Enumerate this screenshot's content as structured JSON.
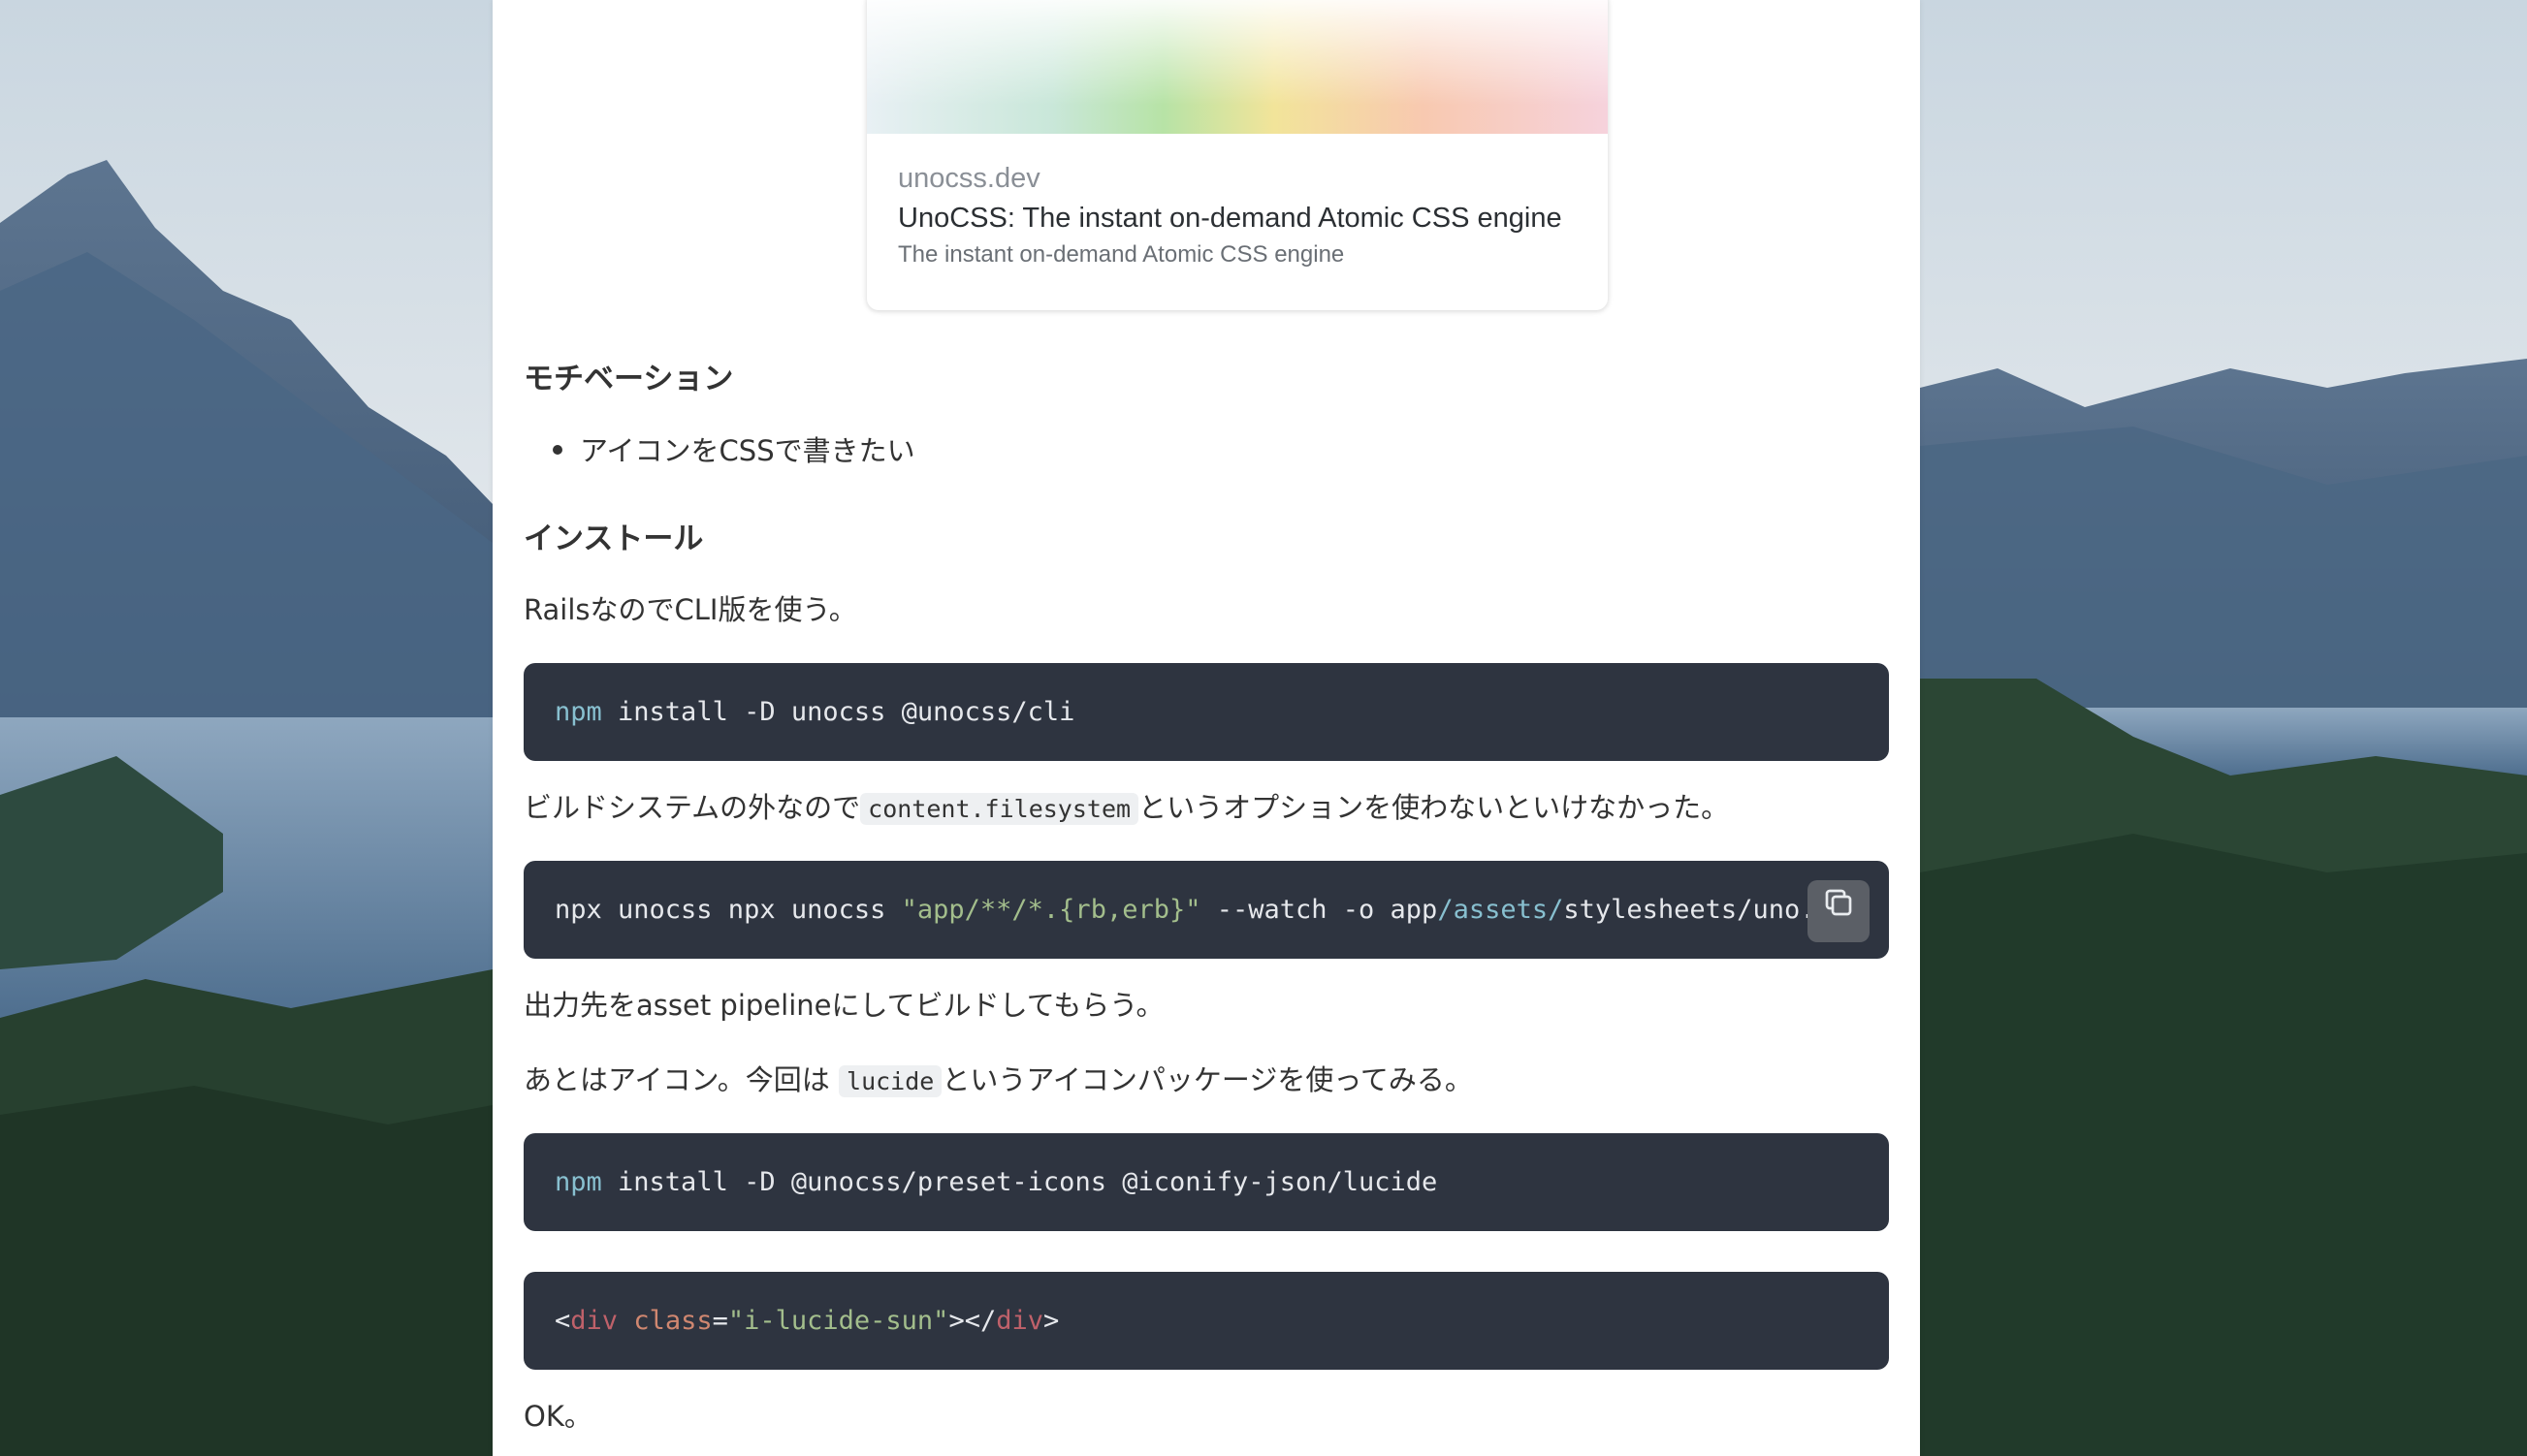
{
  "card": {
    "domain": "unocss.dev",
    "title": "UnoCSS: The instant on-demand Atomic CSS engine",
    "description": "The instant on-demand Atomic CSS engine"
  },
  "sections": {
    "motivation_heading": "モチベーション",
    "motivation_bullet": "アイコンをCSSで書きたい",
    "install_heading": "インストール"
  },
  "paragraphs": {
    "p1": "RailsなのでCLI版を使う。",
    "p2_before": "ビルドシステムの外なので",
    "p2_code": "content.filesystem",
    "p2_after": "というオプションを使わないといけなかった。",
    "p3": "出力先をasset pipelineにしてビルドしてもらう。",
    "p4_before": "あとはアイコン。今回は",
    "p4_code": "lucide",
    "p4_after": "というアイコンパッケージを使ってみる。",
    "p5": "OK。"
  },
  "code_blocks": {
    "install_cli": {
      "cmd": "npm",
      "rest": " install -D unocss @unocss/cli"
    },
    "watch": {
      "part1": "npx unocss npx unocss ",
      "str": "\"app/**/*.{rb,erb}\"",
      "part2": " --watch -o app",
      "path": "/assets/",
      "part3": "stylesheets/uno.css"
    },
    "install_icons": {
      "cmd": "npm",
      "rest": " install -D @unocss/preset-icons @iconify-json/lucide"
    },
    "html": {
      "lt": "<",
      "tag": "div",
      "sp": " ",
      "attr": "class",
      "eq": "=",
      "val": "\"i-lucide-sun\"",
      "mid": "></",
      "tag2": "div",
      "gt": ">"
    }
  },
  "icons": {
    "copy": "copy-icon"
  }
}
